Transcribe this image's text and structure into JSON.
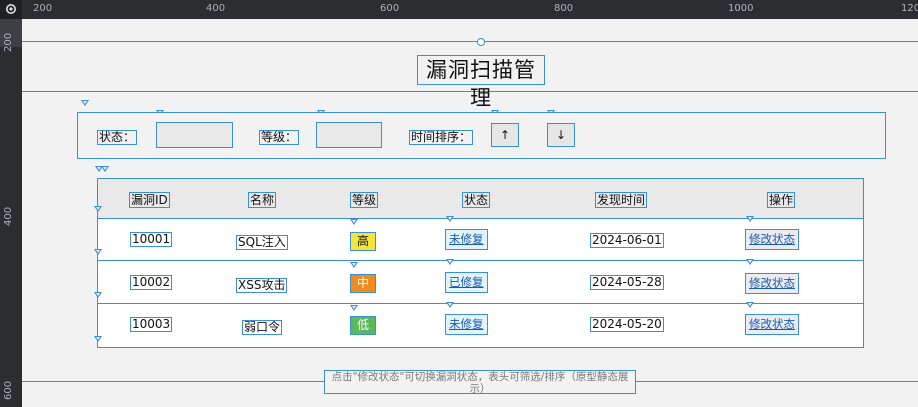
{
  "ruler": {
    "top_labels": [
      "200",
      "400",
      "600",
      "800",
      "1000",
      "120"
    ],
    "left_labels": [
      "200",
      "400",
      "600"
    ]
  },
  "page": {
    "title": "漏洞扫描管理"
  },
  "filters": {
    "status_label": "状态：",
    "level_label": "等级：",
    "sort_label": "时间排序：",
    "sort_asc": "↑",
    "sort_desc": "↓"
  },
  "table": {
    "headers": [
      "漏洞ID",
      "名称",
      "等级",
      "状态",
      "发现时间",
      "操作"
    ],
    "rows": [
      {
        "id": "10001",
        "name": "SQL注入",
        "level": "高",
        "level_color": "#f5e53a",
        "status": "未修复",
        "date": "2024-06-01",
        "action": "修改状态"
      },
      {
        "id": "10002",
        "name": "XSS攻击",
        "level": "中",
        "level_color": "#f08a1c",
        "status": "已修复",
        "date": "2024-05-28",
        "action": "修改状态"
      },
      {
        "id": "10003",
        "name": "弱口令",
        "level": "低",
        "level_color": "#5cb85c",
        "status": "未修复",
        "date": "2024-05-20",
        "action": "修改状态"
      }
    ]
  },
  "footer": {
    "note": "点击\"修改状态\"可切换漏洞状态，表头可筛选/排序（原型静态展示）"
  },
  "colors": {
    "accent": "#3a8fd6",
    "ruler_bg": "#2b2d31"
  },
  "icons": {
    "corner": "gear-icon"
  }
}
